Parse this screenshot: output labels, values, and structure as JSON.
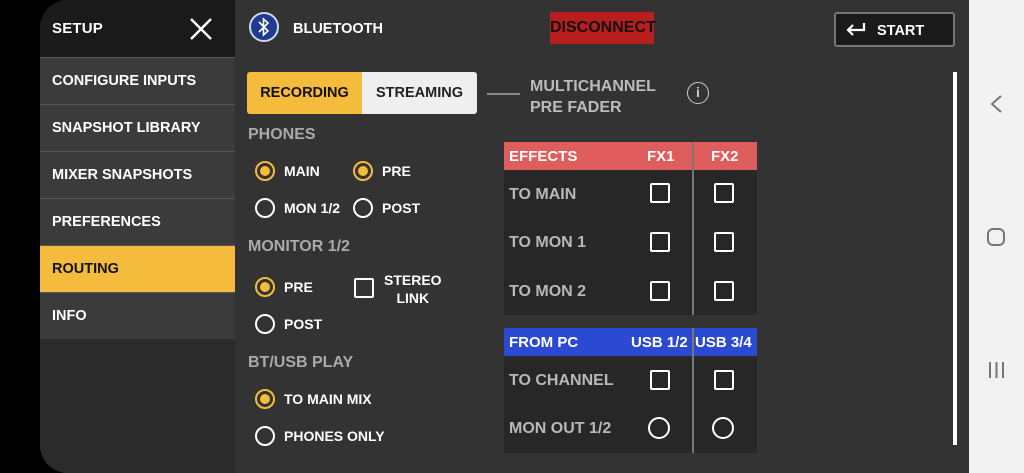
{
  "sidebar": {
    "title": "SETUP",
    "items": [
      {
        "label": "CONFIGURE INPUTS",
        "active": false
      },
      {
        "label": "SNAPSHOT LIBRARY",
        "active": false
      },
      {
        "label": "MIXER SNAPSHOTS",
        "active": false
      },
      {
        "label": "PREFERENCES",
        "active": false
      },
      {
        "label": "ROUTING",
        "active": true
      },
      {
        "label": "INFO",
        "active": false
      }
    ]
  },
  "header": {
    "bluetooth_label": "BLUETOOTH",
    "disconnect_label": "DISCONNECT",
    "start_label": "START"
  },
  "mode": {
    "recording_label": "RECORDING",
    "streaming_label": "STREAMING",
    "selected": "RECORDING",
    "multichannel_line1": "MULTICHANNEL",
    "multichannel_line2": "PRE FADER",
    "info_glyph": "i"
  },
  "phones": {
    "title": "PHONES",
    "main_label": "MAIN",
    "mon_label": "MON 1/2",
    "pre_label": "PRE",
    "post_label": "POST",
    "source_selected": "MAIN",
    "tap_selected": "PRE"
  },
  "monitor": {
    "title": "MONITOR 1/2",
    "pre_label": "PRE",
    "post_label": "POST",
    "stereo_line1": "STEREO",
    "stereo_line2": "LINK",
    "selected": "PRE",
    "stereo_link": false
  },
  "btusb": {
    "title": "BT/USB PLAY",
    "main_mix_label": "TO MAIN MIX",
    "phones_only_label": "PHONES ONLY",
    "selected": "TO MAIN MIX"
  },
  "effects": {
    "title": "EFFECTS",
    "col1": "FX1",
    "col2": "FX2",
    "rows": [
      "TO MAIN",
      "TO MON 1",
      "TO MON 2"
    ]
  },
  "from_pc": {
    "title": "FROM PC",
    "col1": "USB 1/2",
    "col2": "USB 3/4",
    "rows": [
      "TO CHANNEL",
      "MON OUT 1/2"
    ]
  },
  "colors": {
    "accent": "#f5bb3c",
    "disconnect": "#b81e1e",
    "effects_header": "#e05d5d",
    "from_pc_header": "#2c4ad1"
  },
  "icons": [
    "close-icon",
    "bluetooth-icon",
    "return-arrow-icon",
    "info-icon",
    "back-icon",
    "home-icon",
    "recents-icon"
  ]
}
